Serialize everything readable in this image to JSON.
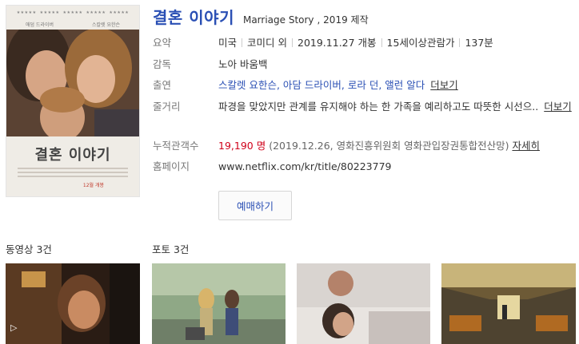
{
  "poster": {
    "critic_quotes": [
      "★★★★★",
      "★★★★★",
      "★★★★★",
      "★★★★★",
      "★★★★★"
    ],
    "actor_left": "애덤 드라이버",
    "actor_right": "스칼렛 요한슨",
    "title": "결혼 이야기",
    "date": "12월 개봉"
  },
  "movie": {
    "title_ko": "결혼 이야기",
    "title_en": "Marriage Story",
    "year": ", 2019 제작"
  },
  "labels": {
    "summary": "요약",
    "director": "감독",
    "cast": "출연",
    "synopsis": "줄거리",
    "audience": "누적관객수",
    "homepage": "홈페이지"
  },
  "summary": {
    "country": "미국",
    "genre": "코미디 외",
    "release": "2019.11.27 개봉",
    "rating": "15세이상관람가",
    "runtime": "137분"
  },
  "director": "노아 바움백",
  "cast": {
    "names": "스칼렛 요한슨, 아담 드라이버, 로라 던, 앨런 알다",
    "more": "더보기"
  },
  "synopsis": {
    "text": "파경을 맞았지만 관계를 유지해야 하는 한 가족을 예리하고도 따뜻한 시선으..",
    "more": "더보기"
  },
  "audience": {
    "count": "19,190 명",
    "note": "(2019.12.26, 영화진흥위원회 영화관입장권통합전산망)",
    "detail": "자세히"
  },
  "homepage": "www.netflix.com/kr/title/80223779",
  "reserve_button": "예매하기",
  "sections": {
    "videos": "동영상 3건",
    "photos": "포토 3건"
  },
  "colors": {
    "title_blue": "#2a4fb4",
    "audience_red": "#d0021b",
    "homepage_green": "#2e8b57"
  }
}
